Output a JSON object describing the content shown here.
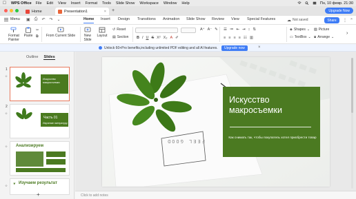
{
  "menubar": {
    "app_name": "WPS Office",
    "items": [
      "File",
      "Edit",
      "View",
      "Insert",
      "Format",
      "Tools",
      "Slide Show",
      "Workspace",
      "Window",
      "Help"
    ],
    "clock": "Пн, 10 февр. 21:30"
  },
  "window": {
    "tabs": [
      {
        "label": "Home",
        "icon": "wps-logo-icon"
      },
      {
        "label": "Presentation1",
        "icon": "presentation-file-icon"
      }
    ],
    "upgrade_label": "Upgrade Now"
  },
  "ribbon": {
    "menu_label": "Menu",
    "tabs": [
      "Home",
      "Insert",
      "Design",
      "Transitions",
      "Animation",
      "Slide Show",
      "Review",
      "View",
      "Special Features"
    ],
    "active_tab": "Home",
    "not_saved": "Not saved",
    "share_label": "Share",
    "tools": {
      "format_painter": "Format\nPainter",
      "paste": "Paste",
      "from_current_slide": "From Current Slide",
      "new_slide": "New\nSlide",
      "layout": "Layout",
      "reset": "Reset",
      "section": "Section",
      "shapes": "Shapes",
      "picture": "Picture",
      "textbox": "TextBox",
      "arrange": "Arrange"
    }
  },
  "notification": {
    "text": "Unlock 60+Pro benefits,including unlimited PDF editing and all AI features.",
    "button": "Upgrade now"
  },
  "left_panel": {
    "tabs": [
      "Outline",
      "Slides"
    ],
    "active_tab": "Slides",
    "slides": [
      {
        "number": "1",
        "title": "Искусство макросъемки"
      },
      {
        "number": "2",
        "title": "Часть 01",
        "subtitle": "Изучение литературу"
      },
      {
        "number": "3",
        "title": "Анализируем"
      },
      {
        "number": "4",
        "title": "Изучаем результат"
      }
    ]
  },
  "slide": {
    "title": "Искусство макросъемки",
    "subtitle": "Как снимать так, чтобы покупатель хотел приобрести товар",
    "paper_text": "FEEL GOOD",
    "accent_color": "#4b7a21"
  },
  "notes": {
    "placeholder": "Click to add notes"
  }
}
